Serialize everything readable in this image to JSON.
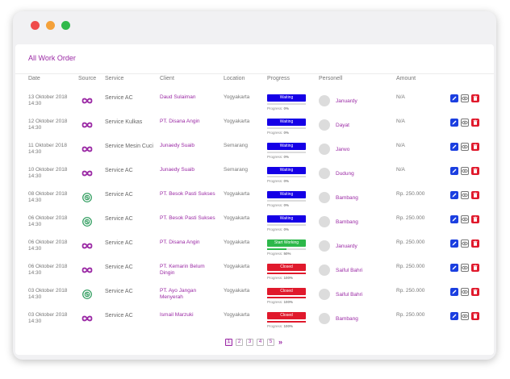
{
  "panel": {
    "title": "All Work Order"
  },
  "columns": [
    "Date",
    "Source",
    "Service",
    "Client",
    "Location",
    "Progress",
    "Personell",
    "Amount"
  ],
  "colors": {
    "accent": "#9b2aa5",
    "waiting": "#1500e6",
    "working": "#2db84a",
    "closed": "#e0192c",
    "source_infinity": "#9b2aa5",
    "source_web": "#2a9a5a"
  },
  "progress_prefix": "Progress:",
  "rows": [
    {
      "date": "13 Oktober 2018 14:30",
      "source": "infinity-icon",
      "service": "Service AC",
      "client": "Daud Sulaiman",
      "location": "Yogyakarta",
      "status": "Waiting",
      "status_type": "waiting",
      "percent": "0%",
      "fraction": 0.0,
      "person": "Januardy",
      "amount": "N/A"
    },
    {
      "date": "12 Oktober 2018 14:30",
      "source": "infinity-icon",
      "service": "Service Kulkas",
      "client": "PT. Disana Angin",
      "location": "Yogyakarta",
      "status": "Waiting",
      "status_type": "waiting",
      "percent": "0%",
      "fraction": 0.0,
      "person": "Dayat",
      "amount": "N/A"
    },
    {
      "date": "11 Oktober 2018 14:30",
      "source": "infinity-icon",
      "service": "Service Mesin Cuci",
      "client": "Junaedy Suaib",
      "location": "Semarang",
      "status": "Waiting",
      "status_type": "waiting",
      "percent": "0%",
      "fraction": 0.0,
      "person": "Jarwo",
      "amount": "N/A"
    },
    {
      "date": "10 Oktober 2018 14:30",
      "source": "infinity-icon",
      "service": "Service AC",
      "client": "Junaedy Suaib",
      "location": "Semarang",
      "status": "Waiting",
      "status_type": "waiting",
      "percent": "0%",
      "fraction": 0.0,
      "person": "Dudung",
      "amount": "N/A"
    },
    {
      "date": "08 Oktober 2018 14:30",
      "source": "web-icon",
      "service": "Service AC",
      "client": "PT. Besok Pasti Sukses",
      "location": "Yogyakarta",
      "status": "Waiting",
      "status_type": "waiting",
      "percent": "0%",
      "fraction": 0.0,
      "person": "Bambang",
      "amount": "Rp. 250.000"
    },
    {
      "date": "06 Oktober 2018 14:30",
      "source": "web-icon",
      "service": "Service AC",
      "client": "PT. Besok Pasti Sukses",
      "location": "Yogyakarta",
      "status": "Waiting",
      "status_type": "waiting",
      "percent": "0%",
      "fraction": 0.0,
      "person": "Bambang",
      "amount": "Rp. 250.000"
    },
    {
      "date": "06 Oktober 2018 14:30",
      "source": "infinity-icon",
      "service": "Service AC",
      "client": "PT. Disana Angin",
      "location": "Yogyakarta",
      "status": "Start Working",
      "status_type": "working",
      "percent": "50%",
      "fraction": 0.5,
      "person": "Januardy",
      "amount": "Rp. 250.000"
    },
    {
      "date": "06 Oktober 2018 14:30",
      "source": "infinity-icon",
      "service": "Service AC",
      "client": "PT. Kemarin Belum Dingin",
      "location": "Yogyakarta",
      "status": "Closed",
      "status_type": "closed",
      "percent": "100%",
      "fraction": 1.0,
      "person": "Saiful Bahri",
      "amount": "Rp. 250.000"
    },
    {
      "date": "03 Oktober 2018 14:30",
      "source": "web-icon",
      "service": "Service AC",
      "client": "PT. Ayo Jangan Menyerah",
      "location": "Yogyakarta",
      "status": "Closed",
      "status_type": "closed",
      "percent": "100%",
      "fraction": 1.0,
      "person": "Saiful Bahri",
      "amount": "Rp. 250.000"
    },
    {
      "date": "03 Oktober 2018 14:30",
      "source": "infinity-icon",
      "service": "Service AC",
      "client": "Ismail Marzuki",
      "location": "Yogyakarta",
      "status": "Closed",
      "status_type": "closed",
      "percent": "100%",
      "fraction": 1.0,
      "person": "Bambang",
      "amount": "Rp. 250.000"
    }
  ],
  "pagination": {
    "pages": [
      "1",
      "2",
      "3",
      "4",
      "5"
    ],
    "current": "1",
    "next": "»"
  }
}
